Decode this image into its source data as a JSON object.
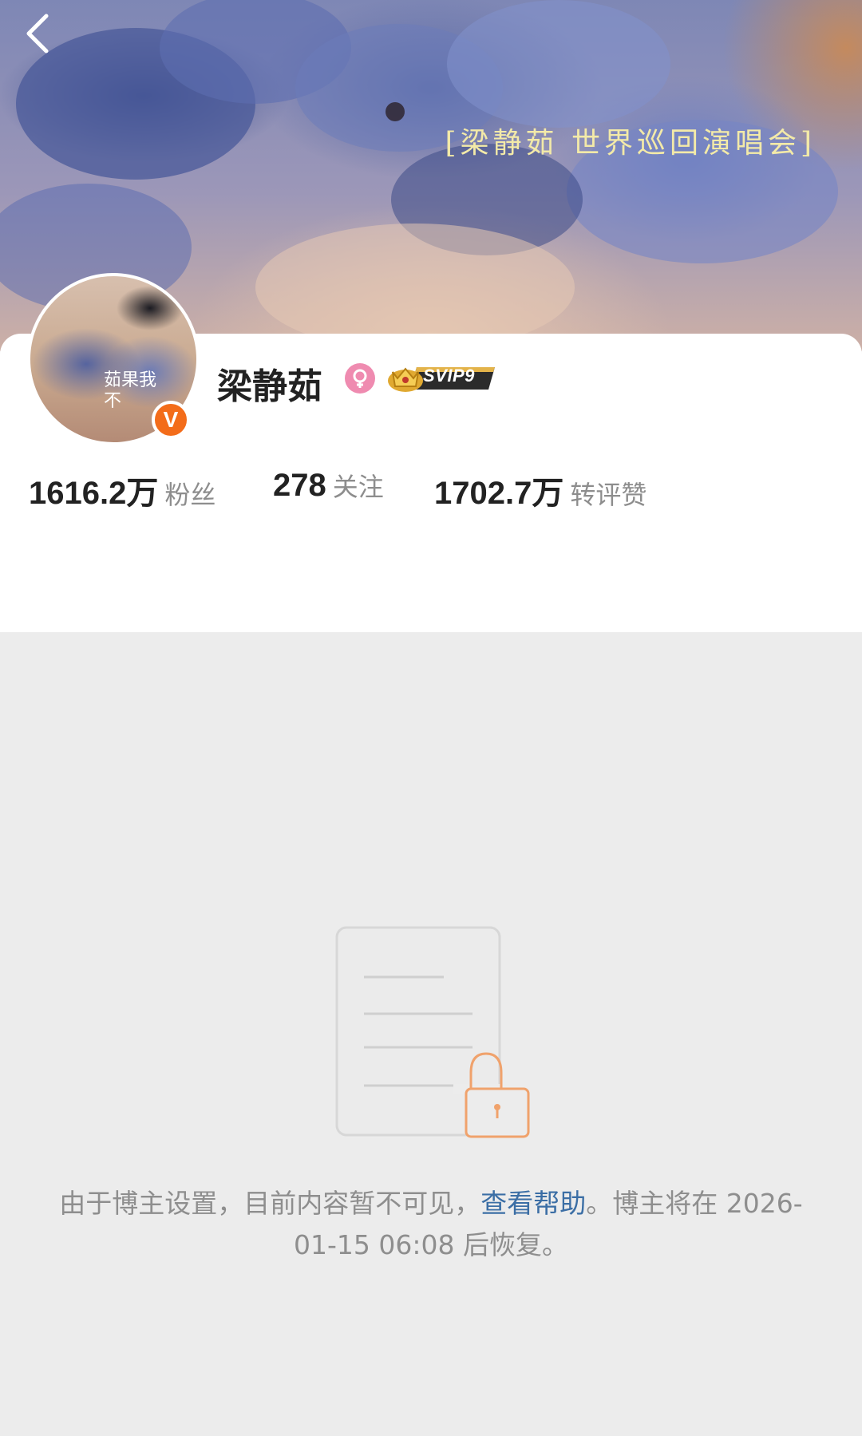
{
  "header": {
    "back_icon": "chevron-left-icon",
    "banner_caption": "[梁静茹 世界巡回演唱会]"
  },
  "profile": {
    "avatar_text": "茹果我不",
    "verified_icon": "verified-v-icon",
    "verified_mark": "V",
    "name": "梁静茹",
    "gender_icon": "female-icon",
    "vip_label": "SVIP9",
    "vip_icon": "crown-icon",
    "colors": {
      "verified": "#f36c1a",
      "gender": "#ef8bb0",
      "vip": "#d4a017"
    }
  },
  "stats": [
    {
      "value": "1616.2万",
      "label": "粉丝"
    },
    {
      "value": "278",
      "label": "关注"
    },
    {
      "value": "1702.7万",
      "label": "转评赞"
    }
  ],
  "locked": {
    "illustration_icon": "locked-document-icon",
    "notice_prefix": "由于博主设置，目前内容暂不可见，",
    "help_link": "查看帮助",
    "notice_suffix": "。博主将在 2026-01-15 06:08 后恢复。",
    "colors": {
      "link": "#3b6ea5",
      "lock": "#f0a26c"
    }
  }
}
